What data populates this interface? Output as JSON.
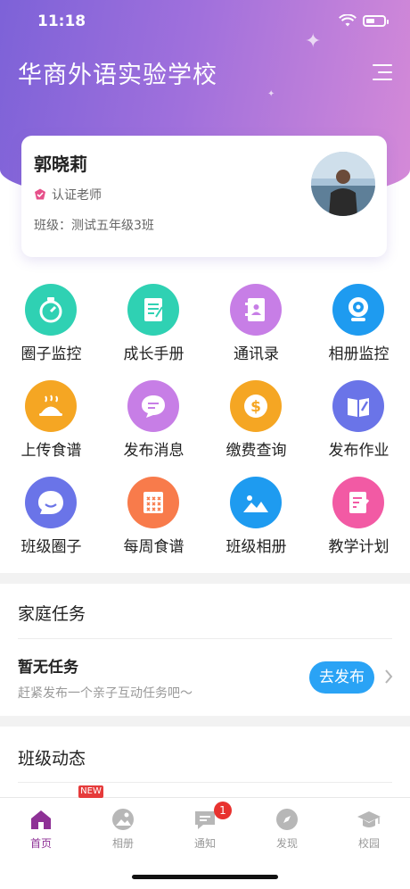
{
  "status": {
    "time": "11:18"
  },
  "header": {
    "title": "华商外语实验学校"
  },
  "profile": {
    "name": "郭晓莉",
    "certification": "认证老师",
    "class_label": "班级：",
    "class_name": "测试五年级3班"
  },
  "grid": [
    {
      "label": "圈子监控",
      "icon": "timer-icon",
      "color": "#2fd1b3"
    },
    {
      "label": "成长手册",
      "icon": "notebook-icon",
      "color": "#2fd1b3"
    },
    {
      "label": "通讯录",
      "icon": "contacts-icon",
      "color": "#c77ee6"
    },
    {
      "label": "相册监控",
      "icon": "camera-icon",
      "color": "#1e9bf0"
    },
    {
      "label": "上传食谱",
      "icon": "cloche-icon",
      "color": "#f5a623"
    },
    {
      "label": "发布消息",
      "icon": "chat-bubble-icon",
      "color": "#c77ee6"
    },
    {
      "label": "缴费查询",
      "icon": "dollar-icon",
      "color": "#f5a623"
    },
    {
      "label": "发布作业",
      "icon": "book-pen-icon",
      "color": "#6a74e8"
    },
    {
      "label": "班级圈子",
      "icon": "smile-bubble-icon",
      "color": "#6a74e8"
    },
    {
      "label": "每周食谱",
      "icon": "calendar-grid-icon",
      "color": "#f87b4b"
    },
    {
      "label": "班级相册",
      "icon": "landscape-icon",
      "color": "#1e9bf0"
    },
    {
      "label": "教学计划",
      "icon": "plan-edit-icon",
      "color": "#f25aa4"
    }
  ],
  "family_tasks": {
    "title": "家庭任务",
    "empty_title": "暂无任务",
    "empty_subtitle": "赶紧发布一个亲子互动任务吧～",
    "publish_label": "去发布"
  },
  "class_news": {
    "title": "班级动态"
  },
  "tabbar": {
    "new_badge": "NEW",
    "notification_count": "1",
    "tabs": [
      {
        "label": "首页",
        "icon": "home-icon",
        "active": true
      },
      {
        "label": "相册",
        "icon": "album-icon",
        "active": false
      },
      {
        "label": "通知",
        "icon": "message-icon",
        "active": false
      },
      {
        "label": "发现",
        "icon": "compass-icon",
        "active": false
      },
      {
        "label": "校园",
        "icon": "graduation-cap-icon",
        "active": false
      }
    ]
  },
  "colors": {
    "accent": "#8e3196",
    "publish_button": "#2aa3f5",
    "header_start": "#7d62d8",
    "header_end": "#d58ad8"
  }
}
